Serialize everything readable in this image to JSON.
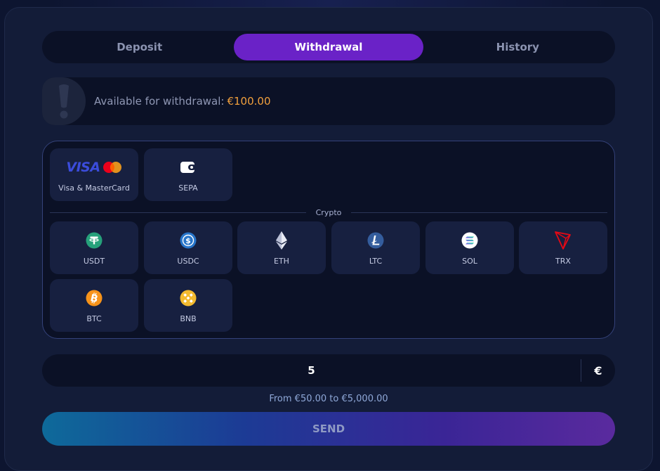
{
  "tabs": [
    {
      "label": "Deposit",
      "active": false
    },
    {
      "label": "Withdrawal",
      "active": true
    },
    {
      "label": "History",
      "active": false
    }
  ],
  "info": {
    "label": "Available for withdrawal:",
    "amount": "€100.00"
  },
  "methods": {
    "fiat": [
      {
        "label": "Visa & MasterCard",
        "icon": "visa-mastercard-icon"
      },
      {
        "label": "SEPA",
        "icon": "wallet-icon"
      }
    ],
    "crypto_heading": "Crypto",
    "crypto": [
      {
        "label": "USDT",
        "icon": "usdt-icon",
        "color": "#26a17b"
      },
      {
        "label": "USDC",
        "icon": "usdc-icon",
        "color": "#2775ca"
      },
      {
        "label": "ETH",
        "icon": "eth-icon",
        "color": "#e8ebf5"
      },
      {
        "label": "LTC",
        "icon": "ltc-icon",
        "color": "#345d9d"
      },
      {
        "label": "SOL",
        "icon": "sol-icon",
        "color": "#9945ff"
      },
      {
        "label": "TRX",
        "icon": "trx-icon",
        "color": "#e50915"
      },
      {
        "label": "BTC",
        "icon": "btc-icon",
        "color": "#f7931a"
      },
      {
        "label": "BNB",
        "icon": "bnb-icon",
        "color": "#f3ba2f"
      }
    ]
  },
  "amount": {
    "value": "5",
    "currency": "€",
    "range_hint": "From €50.00 to €5,000.00"
  },
  "send_label": "SEND",
  "colors": {
    "accent": "#6a22c7",
    "amount_highlight": "#f2a03d"
  },
  "visa_text": "VISA"
}
